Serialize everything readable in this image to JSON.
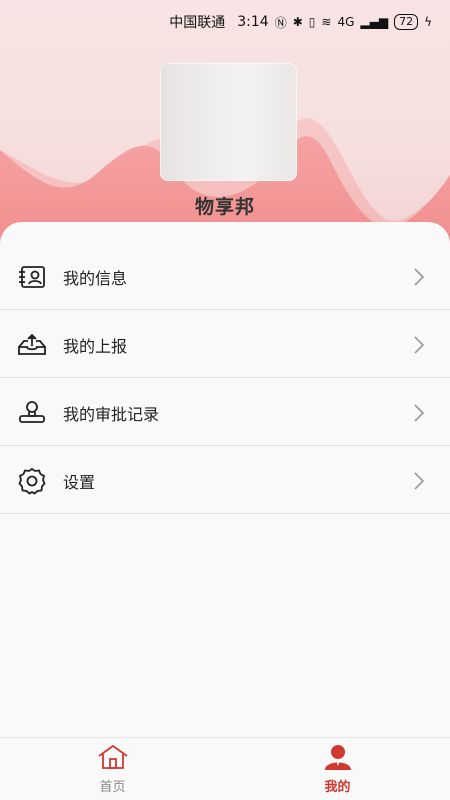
{
  "status_bar": {
    "carrier": "中国联通",
    "time": "3:14",
    "network": "4G",
    "battery": "72"
  },
  "profile": {
    "app_name": "物享邦"
  },
  "menu": {
    "items": [
      {
        "label": "我的信息",
        "icon": "id-card-icon"
      },
      {
        "label": "我的上报",
        "icon": "upload-tray-icon"
      },
      {
        "label": "我的审批记录",
        "icon": "stamp-icon"
      },
      {
        "label": "设置",
        "icon": "gear-icon"
      }
    ]
  },
  "tabs": [
    {
      "label": "首页",
      "icon": "home-icon",
      "active": false
    },
    {
      "label": "我的",
      "icon": "user-icon",
      "active": true
    }
  ],
  "colors": {
    "accent": "#d0392f",
    "wave": "#f29a9a",
    "header_bg": "#f8e4e4"
  }
}
